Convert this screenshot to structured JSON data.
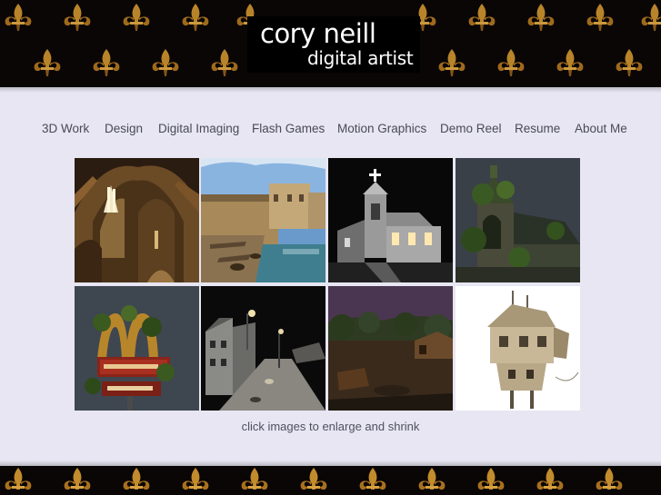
{
  "header": {
    "name": "cory neill",
    "tagline": "digital artist"
  },
  "nav": {
    "items": [
      {
        "label": "3D Work"
      },
      {
        "label": "Design"
      },
      {
        "label": "Digital Imaging"
      },
      {
        "label": "Flash Games"
      },
      {
        "label": "Motion Graphics"
      },
      {
        "label": "Demo Reel"
      },
      {
        "label": "Resume"
      },
      {
        "label": "About Me"
      }
    ]
  },
  "gallery": {
    "thumbnails": [
      {
        "subject": "cathedral-interior"
      },
      {
        "subject": "waterfront-docks"
      },
      {
        "subject": "church-at-night"
      },
      {
        "subject": "overgrown-church"
      },
      {
        "subject": "overgrown-restaurant-sign"
      },
      {
        "subject": "night-street"
      },
      {
        "subject": "swamp-village"
      },
      {
        "subject": "ramshackle-house"
      }
    ]
  },
  "caption": "click images to enlarge and shrink",
  "colors": {
    "background": "#e7e6f2",
    "banner": "#0a0606",
    "fleur": "#c08a2a",
    "nav_text": "#4a4a58"
  }
}
